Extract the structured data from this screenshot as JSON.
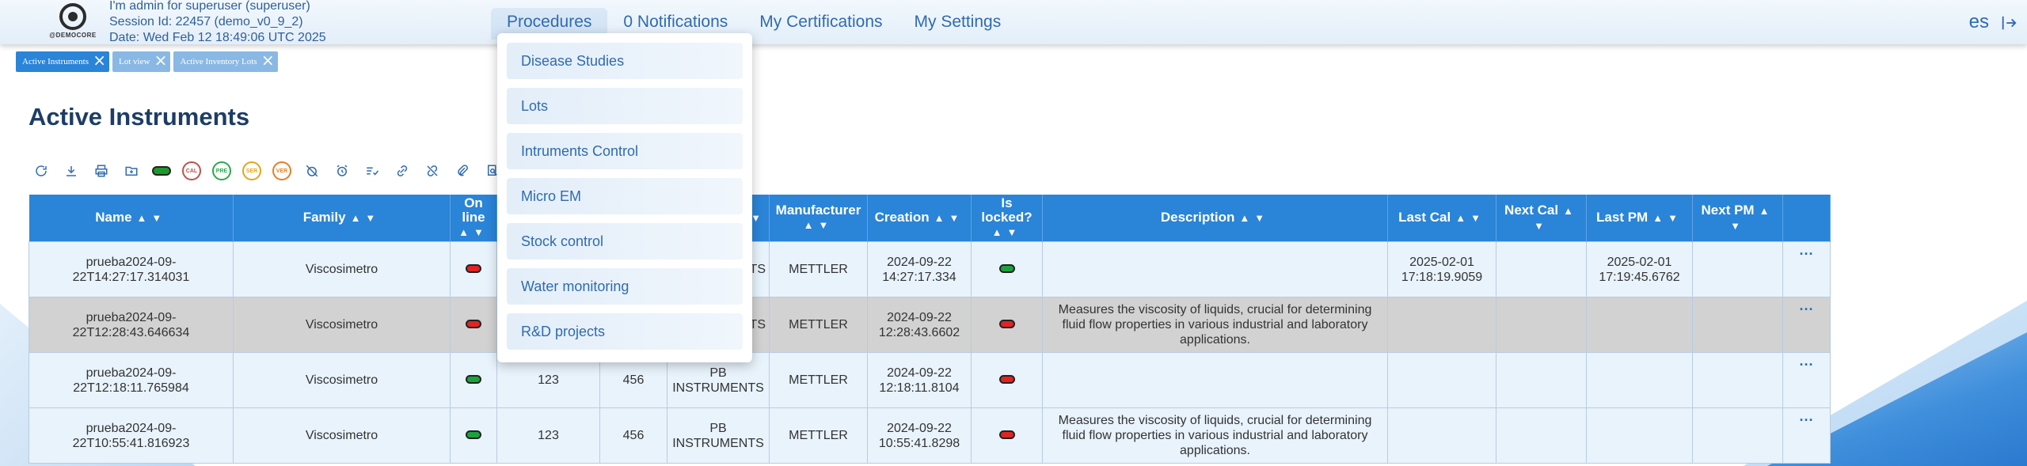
{
  "header": {
    "logo_text": "@DEMOCORE",
    "session_lines": [
      "I'm admin for superuser (superuser)",
      "Session Id: 22457 (demo_v0_9_2)",
      "Date: Wed Feb 12 18:49:06 UTC 2025"
    ],
    "nav": [
      "Procedures",
      "0 Notifications",
      "My Certifications",
      "My Settings"
    ],
    "lang": "es"
  },
  "open_tabs": [
    "Active Instruments",
    "Lot view",
    "Active Inventory Lots"
  ],
  "page_title": "Active Instruments",
  "toolbar_badges": [
    "CAL",
    "PRE",
    "SER",
    "VER"
  ],
  "colors": {
    "primary": "#2a84d8",
    "accent_text": "#2f6bb0",
    "on": "#1aa33c",
    "off": "#e12323"
  },
  "dropdown": {
    "items": [
      "Disease Studies",
      "Lots",
      "Intruments Control",
      "Micro EM",
      "Stock control",
      "Water monitoring",
      "R&D projects"
    ]
  },
  "table": {
    "columns": [
      "Name",
      "Family",
      "On line",
      "",
      "",
      "",
      "Manufacturer",
      "Creation",
      "Is locked?",
      "Description",
      "Last Cal",
      "Next Cal",
      "Last PM",
      "Next PM",
      ""
    ],
    "rows": [
      {
        "name": "prueba2024-09-22T14:27:17.314031",
        "family": "Viscosimetro",
        "online": "off",
        "c4": "",
        "c5": "",
        "c6": "ENTS",
        "manufacturer": "METTLER",
        "creation": "2024-09-22 14:27:17.334",
        "locked": "on",
        "description": "",
        "last_cal": "2025-02-01 17:18:19.9059",
        "next_cal": "",
        "last_pm": "2025-02-01 17:19:45.6762",
        "next_pm": ""
      },
      {
        "name": "prueba2024-09-22T12:28:43.646634",
        "family": "Viscosimetro",
        "online": "off",
        "c4": "",
        "c5": "",
        "c6": "ENTS",
        "manufacturer": "METTLER",
        "creation": "2024-09-22 12:28:43.6602",
        "locked": "off",
        "description": "Measures the viscosity of liquids, crucial for determining fluid flow properties in various industrial and laboratory applications.",
        "last_cal": "",
        "next_cal": "",
        "last_pm": "",
        "next_pm": ""
      },
      {
        "name": "prueba2024-09-22T12:18:11.765984",
        "family": "Viscosimetro",
        "online": "on",
        "c4": "123",
        "c5": "456",
        "c6": "PB INSTRUMENTS",
        "manufacturer": "METTLER",
        "creation": "2024-09-22 12:18:11.8104",
        "locked": "off",
        "description": "",
        "last_cal": "",
        "next_cal": "",
        "last_pm": "",
        "next_pm": ""
      },
      {
        "name": "prueba2024-09-22T10:55:41.816923",
        "family": "Viscosimetro",
        "online": "on",
        "c4": "123",
        "c5": "456",
        "c6": "PB INSTRUMENTS",
        "manufacturer": "METTLER",
        "creation": "2024-09-22 10:55:41.8298",
        "locked": "off",
        "description": "Measures the viscosity of liquids, crucial for determining fluid flow properties in various industrial and laboratory applications.",
        "last_cal": "",
        "next_cal": "",
        "last_pm": "",
        "next_pm": ""
      }
    ],
    "more_label": "···"
  }
}
